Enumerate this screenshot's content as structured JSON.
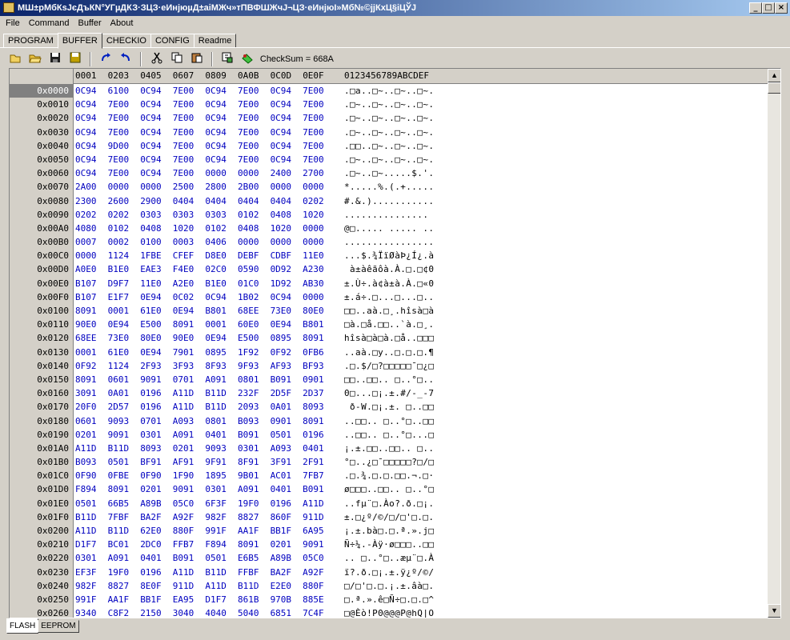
{
  "window": {
    "title": "МШ±рМбКsЈєДъКN°УГµДКЗ·ЗЦЗ·еИнјюµД±аіМЖч»тПВФШЖчЈ¬ЦЗ·еИнјюІ»Мб№©јјКхЦ§іЦЎЈ",
    "minimize": "_",
    "maximize": "□",
    "close": "×"
  },
  "menu": [
    "File",
    "Command",
    "Buffer",
    "About"
  ],
  "tabs": [
    {
      "label": "PROGRAM",
      "active": false
    },
    {
      "label": "BUFFER",
      "active": true
    },
    {
      "label": "CHECKIO",
      "active": false
    },
    {
      "label": "CONFIG",
      "active": false
    },
    {
      "label": "Readme",
      "active": false
    }
  ],
  "toolbar": {
    "icons": [
      "new-icon",
      "open-icon",
      "save-icon",
      "save-as-icon",
      "redo-icon",
      "undo-icon",
      "cut-icon",
      "copy-icon",
      "paste-icon",
      "fill-icon",
      "checksum-icon"
    ],
    "checksum_label": "CheckSum = 668A"
  },
  "grid": {
    "col_headers": [
      "0001",
      "0203",
      "0405",
      "0607",
      "0809",
      "0A0B",
      "0C0D",
      "0E0F"
    ],
    "ascii_header": "0123456789ABCDEF",
    "rows": [
      {
        "addr": "0x0000",
        "hex": [
          "0C94",
          "6100",
          "0C94",
          "7E00",
          "0C94",
          "7E00",
          "0C94",
          "7E00"
        ],
        "ascii": ".□a..□~..□~..□~."
      },
      {
        "addr": "0x0010",
        "hex": [
          "0C94",
          "7E00",
          "0C94",
          "7E00",
          "0C94",
          "7E00",
          "0C94",
          "7E00"
        ],
        "ascii": ".□~..□~..□~..□~."
      },
      {
        "addr": "0x0020",
        "hex": [
          "0C94",
          "7E00",
          "0C94",
          "7E00",
          "0C94",
          "7E00",
          "0C94",
          "7E00"
        ],
        "ascii": ".□~..□~..□~..□~."
      },
      {
        "addr": "0x0030",
        "hex": [
          "0C94",
          "7E00",
          "0C94",
          "7E00",
          "0C94",
          "7E00",
          "0C94",
          "7E00"
        ],
        "ascii": ".□~..□~..□~..□~."
      },
      {
        "addr": "0x0040",
        "hex": [
          "0C94",
          "9D00",
          "0C94",
          "7E00",
          "0C94",
          "7E00",
          "0C94",
          "7E00"
        ],
        "ascii": ".□□..□~..□~..□~."
      },
      {
        "addr": "0x0050",
        "hex": [
          "0C94",
          "7E00",
          "0C94",
          "7E00",
          "0C94",
          "7E00",
          "0C94",
          "7E00"
        ],
        "ascii": ".□~..□~..□~..□~."
      },
      {
        "addr": "0x0060",
        "hex": [
          "0C94",
          "7E00",
          "0C94",
          "7E00",
          "0000",
          "0000",
          "2400",
          "2700"
        ],
        "ascii": ".□~..□~.....$.'."
      },
      {
        "addr": "0x0070",
        "hex": [
          "2A00",
          "0000",
          "0000",
          "2500",
          "2800",
          "2B00",
          "0000",
          "0000"
        ],
        "ascii": "*.....%.(.+....."
      },
      {
        "addr": "0x0080",
        "hex": [
          "2300",
          "2600",
          "2900",
          "0404",
          "0404",
          "0404",
          "0404",
          "0202"
        ],
        "ascii": "#.&.)..........."
      },
      {
        "addr": "0x0090",
        "hex": [
          "0202",
          "0202",
          "0303",
          "0303",
          "0303",
          "0102",
          "0408",
          "1020"
        ],
        "ascii": "..............."
      },
      {
        "addr": "0x00A0",
        "hex": [
          "4080",
          "0102",
          "0408",
          "1020",
          "0102",
          "0408",
          "1020",
          "0000"
        ],
        "ascii": "@□..... ..... .."
      },
      {
        "addr": "0x00B0",
        "hex": [
          "0007",
          "0002",
          "0100",
          "0003",
          "0406",
          "0000",
          "0000",
          "0000"
        ],
        "ascii": "................"
      },
      {
        "addr": "0x00C0",
        "hex": [
          "0000",
          "1124",
          "1FBE",
          "CFEF",
          "D8E0",
          "DEBF",
          "CDBF",
          "11E0"
        ],
        "ascii": "...$.¾ÏïØàÞ¿Í¿.à"
      },
      {
        "addr": "0x00D0",
        "hex": [
          "A0E0",
          "B1E0",
          "EAE3",
          "F4E0",
          "02C0",
          "0590",
          "0D92",
          "A230"
        ],
        "ascii": " à±àêãôà.À.□.□¢0"
      },
      {
        "addr": "0x00E0",
        "hex": [
          "B107",
          "D9F7",
          "11E0",
          "A2E0",
          "B1E0",
          "01C0",
          "1D92",
          "AB30"
        ],
        "ascii": "±.Ù÷.à¢à±à.À.□«0"
      },
      {
        "addr": "0x00F0",
        "hex": [
          "B107",
          "E1F7",
          "0E94",
          "0C02",
          "0C94",
          "1B02",
          "0C94",
          "0000"
        ],
        "ascii": "±.á÷.□...□...□.."
      },
      {
        "addr": "0x0100",
        "hex": [
          "8091",
          "0001",
          "61E0",
          "0E94",
          "B801",
          "68EE",
          "73E0",
          "80E0"
        ],
        "ascii": "□□..aà.□¸.hîsà□à"
      },
      {
        "addr": "0x0110",
        "hex": [
          "90E0",
          "0E94",
          "E500",
          "8091",
          "0001",
          "60E0",
          "0E94",
          "B801"
        ],
        "ascii": "□à.□å.□□..`à.□¸."
      },
      {
        "addr": "0x0120",
        "hex": [
          "68EE",
          "73E0",
          "80E0",
          "90E0",
          "0E94",
          "E500",
          "0895",
          "8091"
        ],
        "ascii": "hîsà□à□à.□å..□□□"
      },
      {
        "addr": "0x0130",
        "hex": [
          "0001",
          "61E0",
          "0E94",
          "7901",
          "0895",
          "1F92",
          "0F92",
          "0FB6"
        ],
        "ascii": "..aà.□y..□.□.□.¶"
      },
      {
        "addr": "0x0140",
        "hex": [
          "0F92",
          "1124",
          "2F93",
          "3F93",
          "8F93",
          "9F93",
          "AF93",
          "BF93"
        ],
        "ascii": ".□.$/□?□□□□□¯□¿□"
      },
      {
        "addr": "0x0150",
        "hex": [
          "8091",
          "0601",
          "9091",
          "0701",
          "A091",
          "0801",
          "B091",
          "0901"
        ],
        "ascii": "□□..□□.. □..°□.."
      },
      {
        "addr": "0x0160",
        "hex": [
          "3091",
          "0A01",
          "0196",
          "A11D",
          "B11D",
          "232F",
          "2D5F",
          "2D37"
        ],
        "ascii": "0□...□¡.±.#/-_-7"
      },
      {
        "addr": "0x0170",
        "hex": [
          "20F0",
          "2D57",
          "0196",
          "A11D",
          "B11D",
          "2093",
          "0A01",
          "8093"
        ],
        "ascii": " ð-W.□¡.±. □..□□"
      },
      {
        "addr": "0x0180",
        "hex": [
          "0601",
          "9093",
          "0701",
          "A093",
          "0801",
          "B093",
          "0901",
          "8091"
        ],
        "ascii": "..□□.. □..°□..□□"
      },
      {
        "addr": "0x0190",
        "hex": [
          "0201",
          "9091",
          "0301",
          "A091",
          "0401",
          "B091",
          "0501",
          "0196"
        ],
        "ascii": "..□□.. □..°□...□"
      },
      {
        "addr": "0x01A0",
        "hex": [
          "A11D",
          "B11D",
          "8093",
          "0201",
          "9093",
          "0301",
          "A093",
          "0401"
        ],
        "ascii": "¡.±.□□..□□.. □.."
      },
      {
        "addr": "0x01B0",
        "hex": [
          "B093",
          "0501",
          "BF91",
          "AF91",
          "9F91",
          "8F91",
          "3F91",
          "2F91"
        ],
        "ascii": "°□..¿□¯□□□□□?□/□"
      },
      {
        "addr": "0x01C0",
        "hex": [
          "0F90",
          "0FBE",
          "0F90",
          "1F90",
          "1895",
          "9B01",
          "AC01",
          "7FB7"
        ],
        "ascii": ".□.¾.□.□.□□.¬.□·"
      },
      {
        "addr": "0x01D0",
        "hex": [
          "F894",
          "8091",
          "0201",
          "9091",
          "0301",
          "A091",
          "0401",
          "B091"
        ],
        "ascii": "ø□□□..□□.. □..°□"
      },
      {
        "addr": "0x01E0",
        "hex": [
          "0501",
          "66B5",
          "A89B",
          "05C0",
          "6F3F",
          "19F0",
          "0196",
          "A11D"
        ],
        "ascii": "..fµ¨□.Ào?.ð.□¡."
      },
      {
        "addr": "0x01F0",
        "hex": [
          "B11D",
          "7FBF",
          "BA2F",
          "A92F",
          "982F",
          "8827",
          "860F",
          "911D"
        ],
        "ascii": "±.□¿º/©/□/□'□.□."
      },
      {
        "addr": "0x0200",
        "hex": [
          "A11D",
          "B11D",
          "62E0",
          "880F",
          "991F",
          "AA1F",
          "BB1F",
          "6A95"
        ],
        "ascii": "¡.±.bà□.□.ª.».j□"
      },
      {
        "addr": "0x0210",
        "hex": [
          "D1F7",
          "BC01",
          "2DC0",
          "FFB7",
          "F894",
          "8091",
          "0201",
          "9091"
        ],
        "ascii": "Ñ÷¼.-Àÿ·ø□□□..□□"
      },
      {
        "addr": "0x0220",
        "hex": [
          "0301",
          "A091",
          "0401",
          "B091",
          "0501",
          "E6B5",
          "A89B",
          "05C0"
        ],
        "ascii": ".. □..°□..æµ¨□.À"
      },
      {
        "addr": "0x0230",
        "hex": [
          "EF3F",
          "19F0",
          "0196",
          "A11D",
          "B11D",
          "FFBF",
          "BA2F",
          "A92F"
        ],
        "ascii": "ï?.ð.□¡.±.ÿ¿º/©/"
      },
      {
        "addr": "0x0240",
        "hex": [
          "982F",
          "8827",
          "8E0F",
          "911D",
          "A11D",
          "B11D",
          "E2E0",
          "880F"
        ],
        "ascii": "□/□'□.□.¡.±.âà□."
      },
      {
        "addr": "0x0250",
        "hex": [
          "991F",
          "AA1F",
          "BB1F",
          "EA95",
          "D1F7",
          "861B",
          "970B",
          "885E"
        ],
        "ascii": "□.ª.».ê□Ñ÷□.□.□^"
      },
      {
        "addr": "0x0260",
        "hex": [
          "9340",
          "C8F2",
          "2150",
          "3040",
          "4040",
          "5040",
          "6851",
          "7C4F"
        ],
        "ascii": "□@Èò!P0@@@P@hQ|O"
      }
    ]
  },
  "bottom_tabs": [
    {
      "label": "FLASH",
      "active": true
    },
    {
      "label": "EEPROM",
      "active": false
    }
  ]
}
